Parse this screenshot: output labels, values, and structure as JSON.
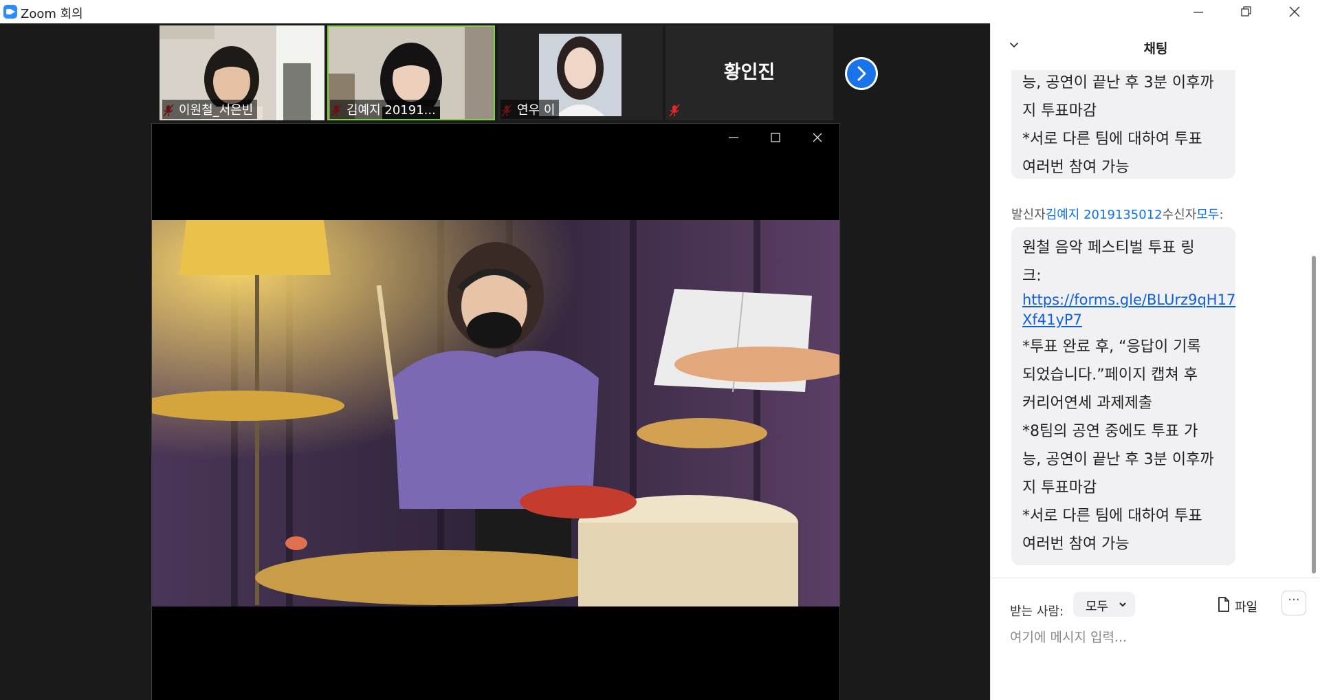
{
  "window": {
    "title": "Zoom 회의"
  },
  "participants": [
    {
      "name": "이원철_서은빈",
      "muted": true
    },
    {
      "name": "김예지 20191...",
      "muted": true,
      "active": true
    },
    {
      "name": "연우 이",
      "muted": true
    },
    {
      "name": "황인진",
      "muted": true
    }
  ],
  "chat": {
    "title": "채팅",
    "prev_message": {
      "lines": [
        "능, 공연이 끝난 후 3분 이후까",
        "지 투표마감",
        "*서로 다른 팀에 대하여 투표",
        "여러번 참여 가능"
      ]
    },
    "sender_line": {
      "prefix": "발신자",
      "sender": "김예지 2019135012",
      "mid": "수신자",
      "recipient": "모두",
      "suffix": ":"
    },
    "message": {
      "lines_before": [
        "원철 음악 페스티벌 투표 링",
        "크:"
      ],
      "link": [
        "https://forms.gle/BLUrz9qH17",
        "Xf41yP7"
      ],
      "lines_after": [
        "*투표 완료 후, “응답이 기록",
        "되었습니다.”페이지 캡쳐 후",
        "커리어연세 과제제출",
        "*8팀의 공연 중에도 투표 가",
        "능, 공연이 끝난 후 3분 이후까",
        "지 투표마감",
        "*서로 다른 팀에 대하여 투표",
        "여러번 참여 가능"
      ]
    },
    "to_label": "받는 사람:",
    "to_value": "모두",
    "file_label": "파일",
    "more_label": "···",
    "input_placeholder": "여기에 메시지 입력..."
  },
  "colors": {
    "accent": "#0e72ed",
    "active_border": "#7fd33b",
    "mute_red": "#e02828"
  }
}
